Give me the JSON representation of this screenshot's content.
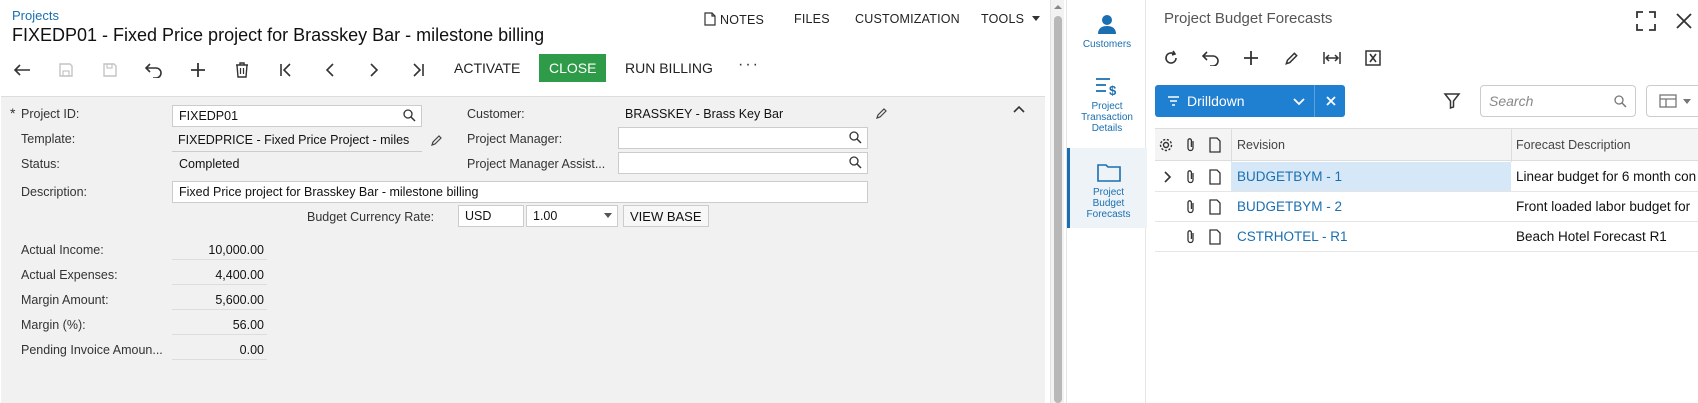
{
  "main": {
    "breadcrumb": "Projects",
    "title": "FIXEDP01 - Fixed Price project for Brasskey Bar - milestone billing",
    "top_actions": [
      "NOTES",
      "FILES",
      "CUSTOMIZATION",
      "TOOLS"
    ],
    "toolbar": {
      "activate": "ACTIVATE",
      "close": "CLOSE",
      "run_billing": "RUN BILLING",
      "more": "···"
    },
    "form": {
      "project_id_label": "Project ID:",
      "project_id": "FIXEDP01",
      "template_label": "Template:",
      "template": "FIXEDPRICE - Fixed Price Project - miles",
      "status_label": "Status:",
      "status": "Completed",
      "description_label": "Description:",
      "description": "Fixed Price project for Brasskey Bar - milestone billing",
      "customer_label": "Customer:",
      "customer": "BRASSKEY - Brass Key Bar",
      "pm_label": "Project Manager:",
      "pm": "",
      "pm_assist_label": "Project Manager Assist...",
      "pm_assist": "",
      "budget_rate_label": "Budget Currency Rate:",
      "currency": "USD",
      "rate": "1.00",
      "view_base": "VIEW BASE",
      "actual_income_label": "Actual Income:",
      "actual_income": "10,000.00",
      "actual_expenses_label": "Actual Expenses:",
      "actual_expenses": "4,400.00",
      "margin_amount_label": "Margin Amount:",
      "margin_amount": "5,600.00",
      "margin_pct_label": "Margin (%):",
      "margin_pct": "56.00",
      "pending_invoice_label": "Pending Invoice Amoun...",
      "pending_invoice": "0.00"
    }
  },
  "rail": {
    "customers": "Customers",
    "transaction_details": [
      "Project",
      "Transaction",
      "Details"
    ],
    "budget_forecasts": [
      "Project",
      "Budget",
      "Forecasts"
    ]
  },
  "side": {
    "title": "Project Budget Forecasts",
    "drilldown": "Drilldown",
    "search_placeholder": "Search",
    "columns": {
      "revision": "Revision",
      "forecast_description": "Forecast Description"
    },
    "rows": [
      {
        "revision": "BUDGETBYM - 1",
        "description": "Linear budget for 6 month con"
      },
      {
        "revision": "BUDGETBYM - 2",
        "description": "Front loaded labor budget for"
      },
      {
        "revision": "CSTRHOTEL - R1",
        "description": "Beach Hotel Forecast R1"
      }
    ]
  },
  "colors": {
    "accent": "#1a6fb0",
    "close_button": "#2e9b48",
    "drilldown": "#1f7fd0"
  }
}
